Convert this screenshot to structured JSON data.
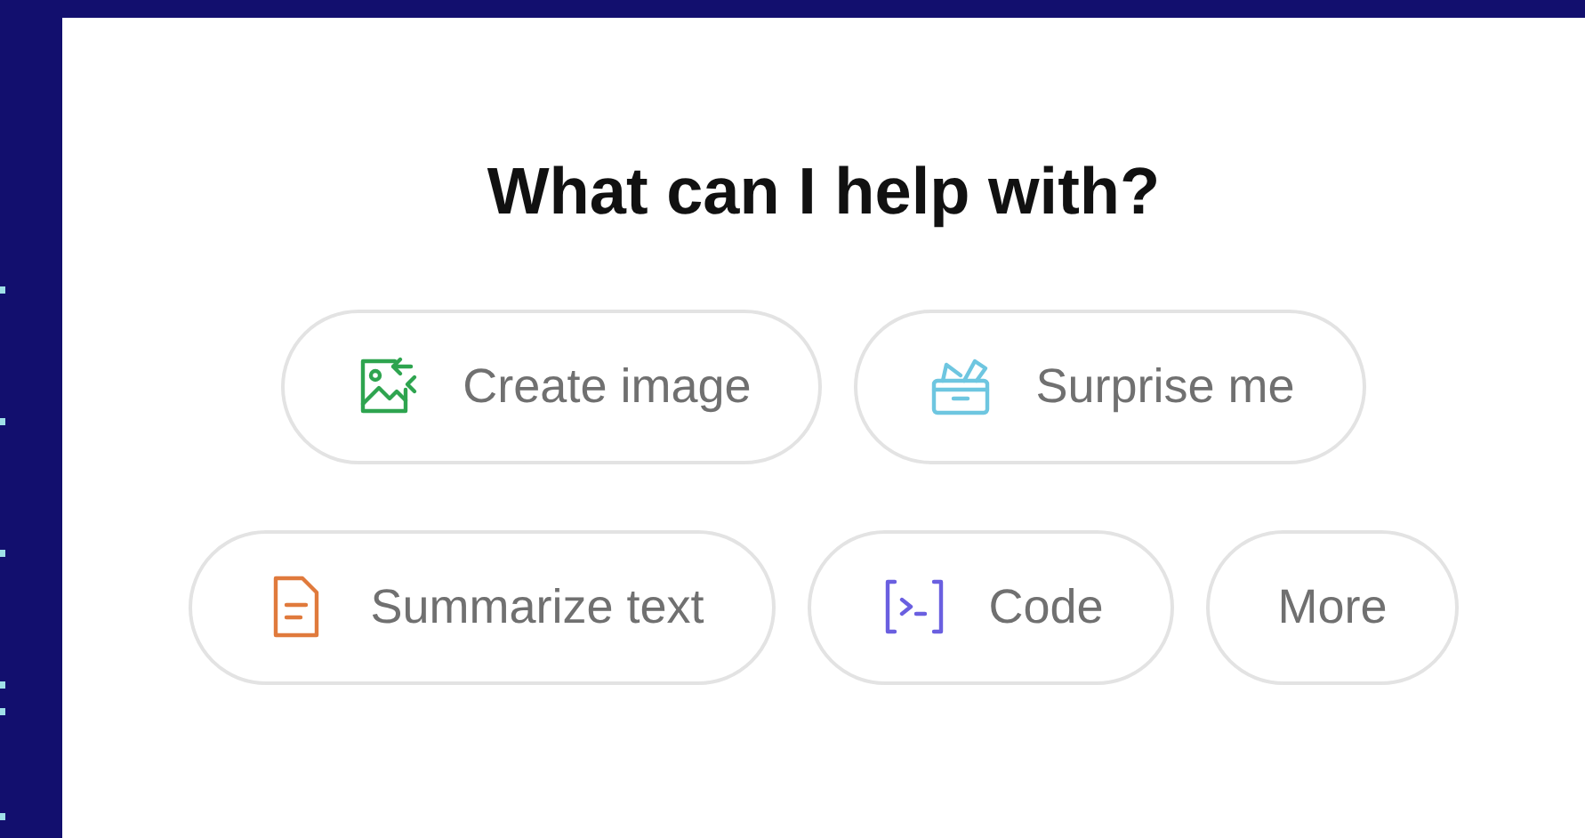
{
  "heading": "What can I help with?",
  "suggestions": [
    [
      {
        "kind": "image",
        "label": "Create image"
      },
      {
        "kind": "surprise",
        "label": "Surprise me"
      }
    ],
    [
      {
        "kind": "summarize",
        "label": "Summarize text"
      },
      {
        "kind": "code",
        "label": "Code"
      },
      {
        "kind": "more",
        "label": "More"
      }
    ]
  ]
}
